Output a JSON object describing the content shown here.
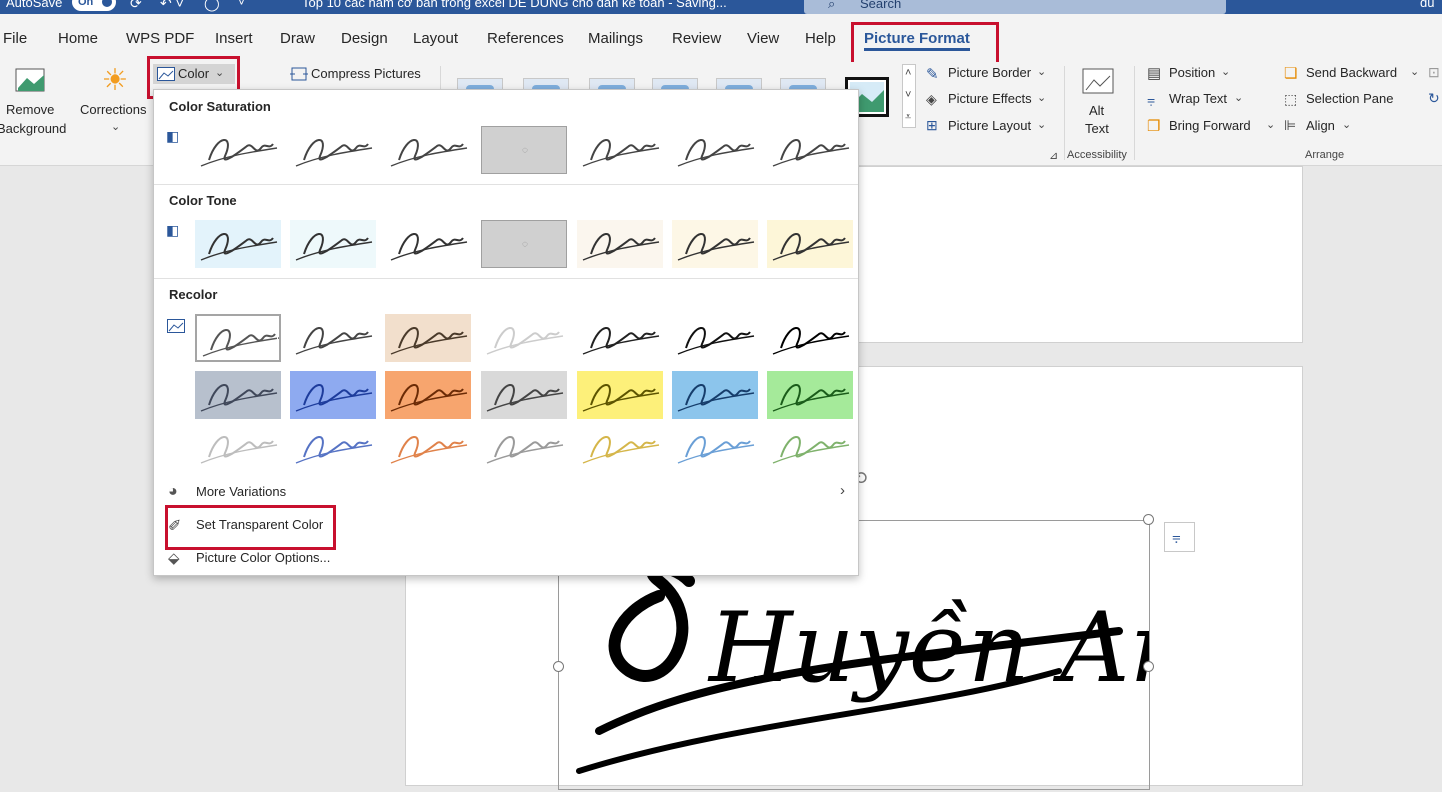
{
  "titlebar": {
    "autosave_label": "AutoSave",
    "autosave_state": "On",
    "doc_title": "Top 10 các hàm cơ bản trong excel DỄ DÙNG cho dân kế toán - Saving...",
    "search_placeholder": "Search",
    "user_fragment": "du"
  },
  "tabs": [
    "File",
    "Home",
    "WPS PDF",
    "Insert",
    "Draw",
    "Design",
    "Layout",
    "References",
    "Mailings",
    "Review",
    "View",
    "Help",
    "Picture Format"
  ],
  "ribbon": {
    "remove_background": [
      "Remove",
      "Background"
    ],
    "corrections": "Corrections",
    "color": "Color",
    "compress_pictures": "Compress Pictures",
    "picture_border": "Picture Border",
    "picture_effects": "Picture Effects",
    "picture_layout": "Picture Layout",
    "alt_text": [
      "Alt",
      "Text"
    ],
    "accessibility": "Accessibility",
    "position": "Position",
    "wrap_text": "Wrap Text",
    "bring_forward": "Bring Forward",
    "send_backward": "Send Backward",
    "selection_pane": "Selection Pane",
    "align": "Align",
    "arrange": "Arrange"
  },
  "color_menu": {
    "saturation_title": "Color Saturation",
    "tone_title": "Color Tone",
    "recolor_title": "Recolor",
    "more_variations": "More Variations",
    "set_transparent": "Set Transparent Color",
    "picture_color_options": "Picture Color Options...",
    "saturation_swatches": [
      "#ffffff",
      "#ffffff",
      "#ffffff",
      "loading",
      "#ffffff",
      "#ffffff",
      "#ffffff"
    ],
    "tone_swatches": [
      "#e3f3fb",
      "#eef9fb",
      "#ffffff",
      "loading",
      "#fbf6ee",
      "#fdf7e6",
      "#fdf6d8"
    ],
    "recolor_rows": [
      [
        "#ffffff",
        "#ffffff",
        "#f2dfcc",
        "#ffffff",
        "#ffffff",
        "#ffffff",
        "#ffffff"
      ],
      [
        "#b7c0cd",
        "#8eaaf0",
        "#f7a56e",
        "#d9d9d9",
        "#fdf07a",
        "#8cc5ec",
        "#a5ea9a"
      ],
      [
        "#ffffff",
        "#ffffff",
        "#ffffff",
        "#ffffff",
        "#ffffff",
        "#ffffff",
        "#ffffff"
      ]
    ],
    "recolor_ink": [
      [
        "#555555",
        "#444444",
        "#4a3a2a",
        "#cccccc",
        "#222222",
        "#111111",
        "#000000"
      ],
      [
        "#40485a",
        "#1d3c9c",
        "#6b2b06",
        "#444444",
        "#5d5400",
        "#163d6b",
        "#1a5c1a"
      ],
      [
        "#bdbdbd",
        "#5673c4",
        "#e0824a",
        "#9a9a9a",
        "#d5b64a",
        "#6a9fd6",
        "#7fb26c"
      ]
    ]
  },
  "document": {
    "signature_text": "Huyền Anh"
  }
}
